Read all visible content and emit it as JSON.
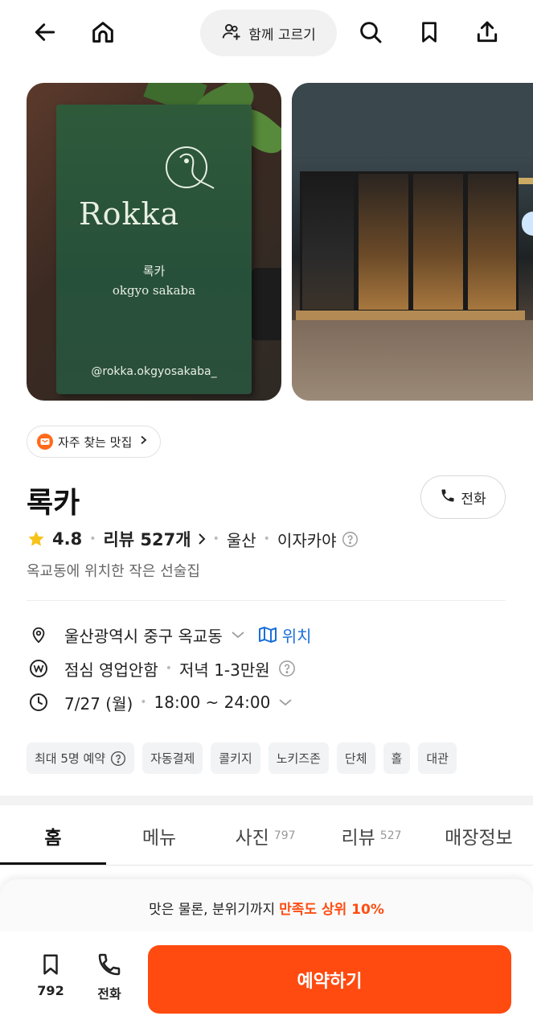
{
  "header": {
    "together_label": "함께 고르기"
  },
  "photos": {
    "sign_brand": "Rokka",
    "sign_korean": "록카",
    "sign_english": "okgyo sakaba",
    "sign_handle": "@rokka.okgyosakaba_"
  },
  "badge": {
    "label": "자주 찾는 맛집"
  },
  "store": {
    "name": "록카",
    "call_label": "전화",
    "rating": "4.8",
    "review_label": "리뷰 527개",
    "region": "울산",
    "category": "이자카야",
    "description": "옥교동에 위치한 작은 선술집"
  },
  "info": {
    "address": "울산광역시 중구 옥교동",
    "map_label": "위치",
    "lunch": "점심 영업안함",
    "dinner_price": "저녁 1-3만원",
    "date": "7/27 (월)",
    "hours": "18:00 ~ 24:00"
  },
  "chips": [
    "최대 5명 예약",
    "자동결제",
    "콜키지",
    "노키즈존",
    "단체",
    "홀",
    "대관"
  ],
  "tabs": [
    {
      "label": "홈",
      "count": ""
    },
    {
      "label": "메뉴",
      "count": ""
    },
    {
      "label": "사진",
      "count": "797"
    },
    {
      "label": "리뷰",
      "count": "527"
    },
    {
      "label": "매장정보",
      "count": ""
    }
  ],
  "promo": {
    "text": "맛은 물론, 분위기까지",
    "highlight": "만족도 상위 10%"
  },
  "bottom": {
    "save_count": "792",
    "call_label": "전화",
    "reserve_label": "예약하기"
  },
  "colors": {
    "accent": "#ff4a10",
    "link": "#1a6fd9",
    "star": "#f7c31a"
  }
}
